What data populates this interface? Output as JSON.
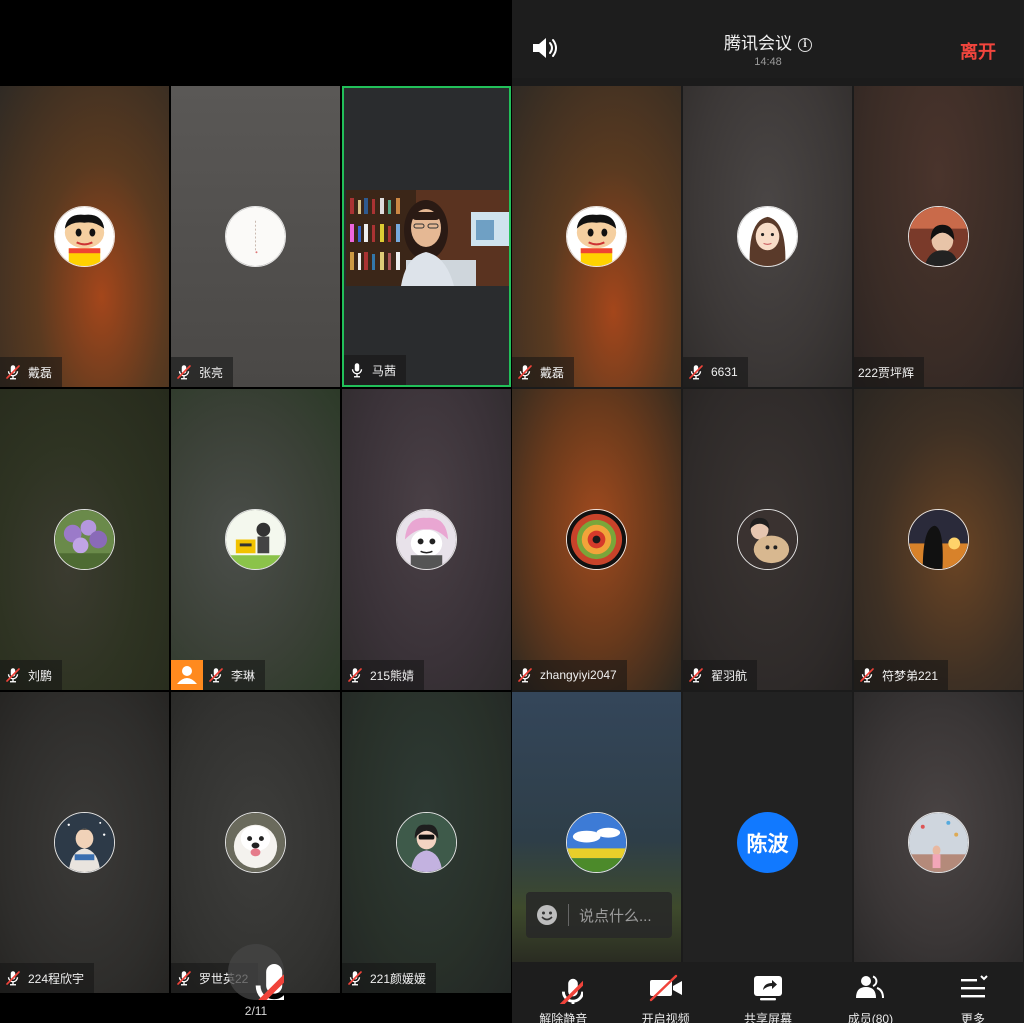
{
  "header": {
    "title": "腾讯会议",
    "time": "14:48",
    "leave_label": "离开"
  },
  "left_tiles": [
    {
      "name": "戴磊",
      "muted": true
    },
    {
      "name": "张亮",
      "muted": true
    },
    {
      "name": "马茜",
      "muted": false,
      "speaking": true
    },
    {
      "name": "刘鹏",
      "muted": true
    },
    {
      "name": "李琳",
      "muted": true
    },
    {
      "name": "215熊婧",
      "muted": true
    },
    {
      "name": "224程欣宇",
      "muted": true
    },
    {
      "name": "罗世英22",
      "muted": true
    },
    {
      "name": "221颜媛媛",
      "muted": true
    }
  ],
  "right_tiles": [
    {
      "name": "戴磊",
      "muted": true
    },
    {
      "name": "6631",
      "muted": true
    },
    {
      "name": "222贾坪辉",
      "muted": false
    },
    {
      "name": "zhangyiyi2047",
      "muted": true
    },
    {
      "name": "翟羽航",
      "muted": true
    },
    {
      "name": "符梦弟221",
      "muted": true
    },
    {
      "name": "",
      "muted": false
    },
    {
      "name": "",
      "muted": false,
      "avatar_text": "陈波"
    },
    {
      "name": "",
      "muted": false
    }
  ],
  "page_indicator": "2/11",
  "chat": {
    "placeholder": "说点什么..."
  },
  "toolbar": {
    "unmute": "解除静音",
    "start_video": "开启视频",
    "share_screen": "共享屏幕",
    "members": "成员(80)",
    "more": "更多"
  },
  "colors": {
    "active_border": "#22c05a",
    "leave_red": "#f2453d",
    "chen_avatar_blue": "#1179ff",
    "host_badge_orange": "#ff8a1e"
  }
}
